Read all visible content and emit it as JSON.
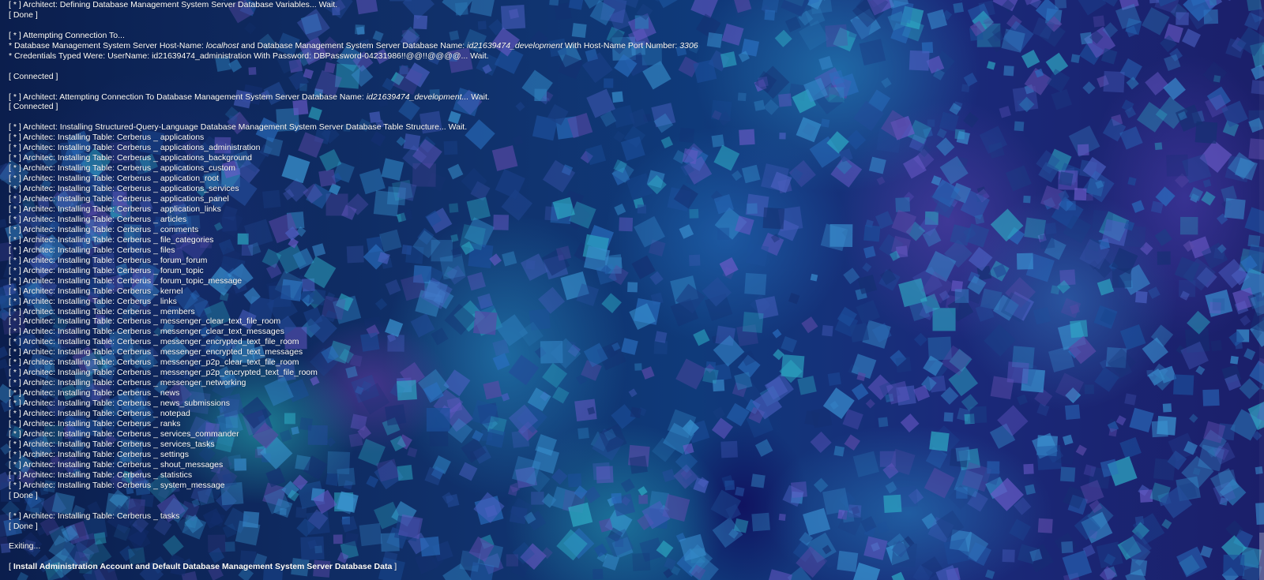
{
  "console": {
    "header_lines": [
      "[ * ] Architect: Defining Database Management System Server Database Variables... Wait.",
      "[ Done ]"
    ],
    "connection": {
      "attempting": "[ * ] Attempting Connection To...",
      "host_prefix": "* Database Management System Server Host-Name: ",
      "host_value": "localhost",
      "db_prefix": " and Database Management System Server Database Name: ",
      "db_value": "id21639474_development",
      "port_prefix": " With Host-Name Port Number: ",
      "port_value": "3306",
      "credentials": "* Credentials Typed Were: UserName: id21639474_administration With Password: DBPassword-04231986!!@@!!@@@@... Wait.",
      "connected": "[ Connected ]"
    },
    "db_connection": {
      "prefix": "[ * ] Architect: Attempting Connection To Database Management System Server Database Name: ",
      "db_value": "id21639474_development...",
      "suffix": " Wait.",
      "connected": "[ Connected ]"
    },
    "install_header": "[ * ] Architect: Installing Structured-Query-Language Database Management System Server Database Table Structure... Wait.",
    "table_prefix": "[ * ] Architec: Installing Table: Cerberus _ ",
    "tables": [
      "applications",
      "applications_administration",
      "applications_background",
      "applications_custom",
      "application_root",
      "applications_services",
      "applications_panel",
      "application_links",
      "articles",
      "comments",
      "file_categories",
      "files",
      "forum_forum",
      "forum_topic",
      "forum_topic_message",
      "kernel",
      "links",
      "members",
      "messenger_clear_text_file_room",
      "messenger_clear_text_messages",
      "messenger_encrypted_text_file_room",
      "messenger_encrypted_text_messages",
      "messenger_p2p_clear_text_file_room",
      "messenger_p2p_encrypted_text_file_room",
      "messenger_networking",
      "news",
      "news_submissions",
      "notepad",
      "ranks",
      "services_commander",
      "services_tasks",
      "settings",
      "shout_messages",
      "statistics",
      "system_message"
    ],
    "done_1": "[ Done ]",
    "tasks_line": "[ * ] Architec: Installing Table: Cerberus _ tasks",
    "done_2": "[ Done ]",
    "exiting": "Exiting...",
    "install_link_open": "[ ",
    "install_link_label": "Install Administration Account and Default Database Management System Server Database Data",
    "install_link_close": " ]"
  },
  "colors": {
    "text": "#ffffff",
    "background_base": "#0f2d6a"
  }
}
